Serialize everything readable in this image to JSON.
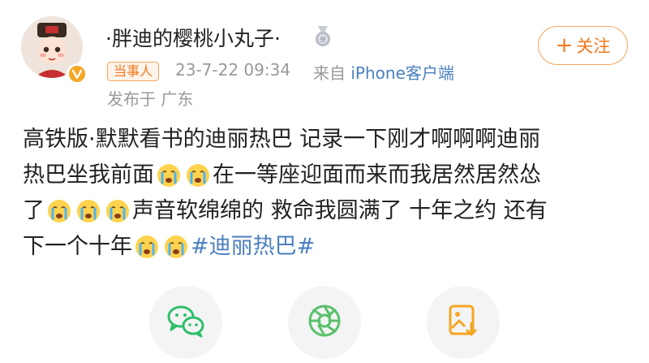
{
  "user": {
    "name": "·胖迪的樱桃小丸子·",
    "follow_label": "关注",
    "tag": "当事人",
    "time": "23-7-22 09:34",
    "from_prefix": "来自",
    "source": "iPhone客户端",
    "location": "发布于 广东"
  },
  "post": {
    "line1": "高铁版·默默看书的迪丽热巴 记录一下刚才啊啊啊迪丽",
    "line2_text": "热巴坐我前面",
    "line2_tail": "在一等座迎面而来而我居然居然怂",
    "line3_head": "了",
    "line3_tail": "声音软绵绵的 救命我圆满了 十年之约 还有",
    "line4_text": "下一个十年",
    "hashtag": "#迪丽热巴#"
  },
  "icons": {
    "accent": "#f2771d",
    "wechat_color": "#2fbf6a",
    "moments_color": "#5ac06b",
    "save_color": "#f5a623"
  }
}
